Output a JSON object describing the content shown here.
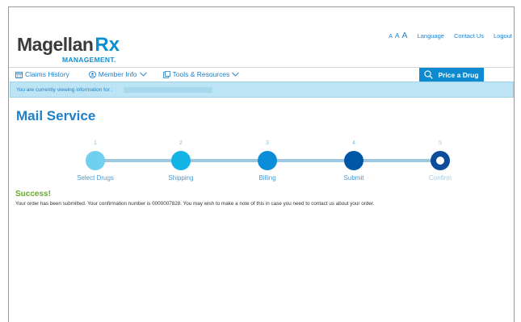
{
  "header": {
    "logo_main": "Magellan",
    "logo_rx": "Rx",
    "logo_sub": "MANAGEMENT.",
    "font_size_small": "A",
    "font_size_medium": "A",
    "font_size_large": "A",
    "language": "Language",
    "contact_us": "Contact Us",
    "logout": "Logout"
  },
  "nav": {
    "claims_history": "Claims History",
    "member_info": "Member Info",
    "tools_resources": "Tools & Resources",
    "price_drug": "Price a Drug"
  },
  "banner": {
    "text": "You are currently viewing information for :"
  },
  "page": {
    "title": "Mail Service"
  },
  "steps": [
    {
      "number": "1",
      "label": "Select Drugs",
      "color": "#6fd0ef"
    },
    {
      "number": "2",
      "label": "Shipping",
      "color": "#12b4e6"
    },
    {
      "number": "3",
      "label": "Billing",
      "color": "#0b8dd8"
    },
    {
      "number": "4",
      "label": "Submit",
      "color": "#0057a8"
    },
    {
      "number": "5",
      "label": "Confirm",
      "color": "#0b4d9a"
    }
  ],
  "result": {
    "title": "Success!",
    "message": "Your order has been submitted. Your confirmation number is 0000007828. You may wish to make a note of this in case you need to contact us about your order."
  },
  "colors": {
    "brand_blue": "#0a8fd1",
    "link_blue": "#1f7fc8",
    "success_green": "#68a932",
    "banner_bg": "#bde4f4"
  }
}
